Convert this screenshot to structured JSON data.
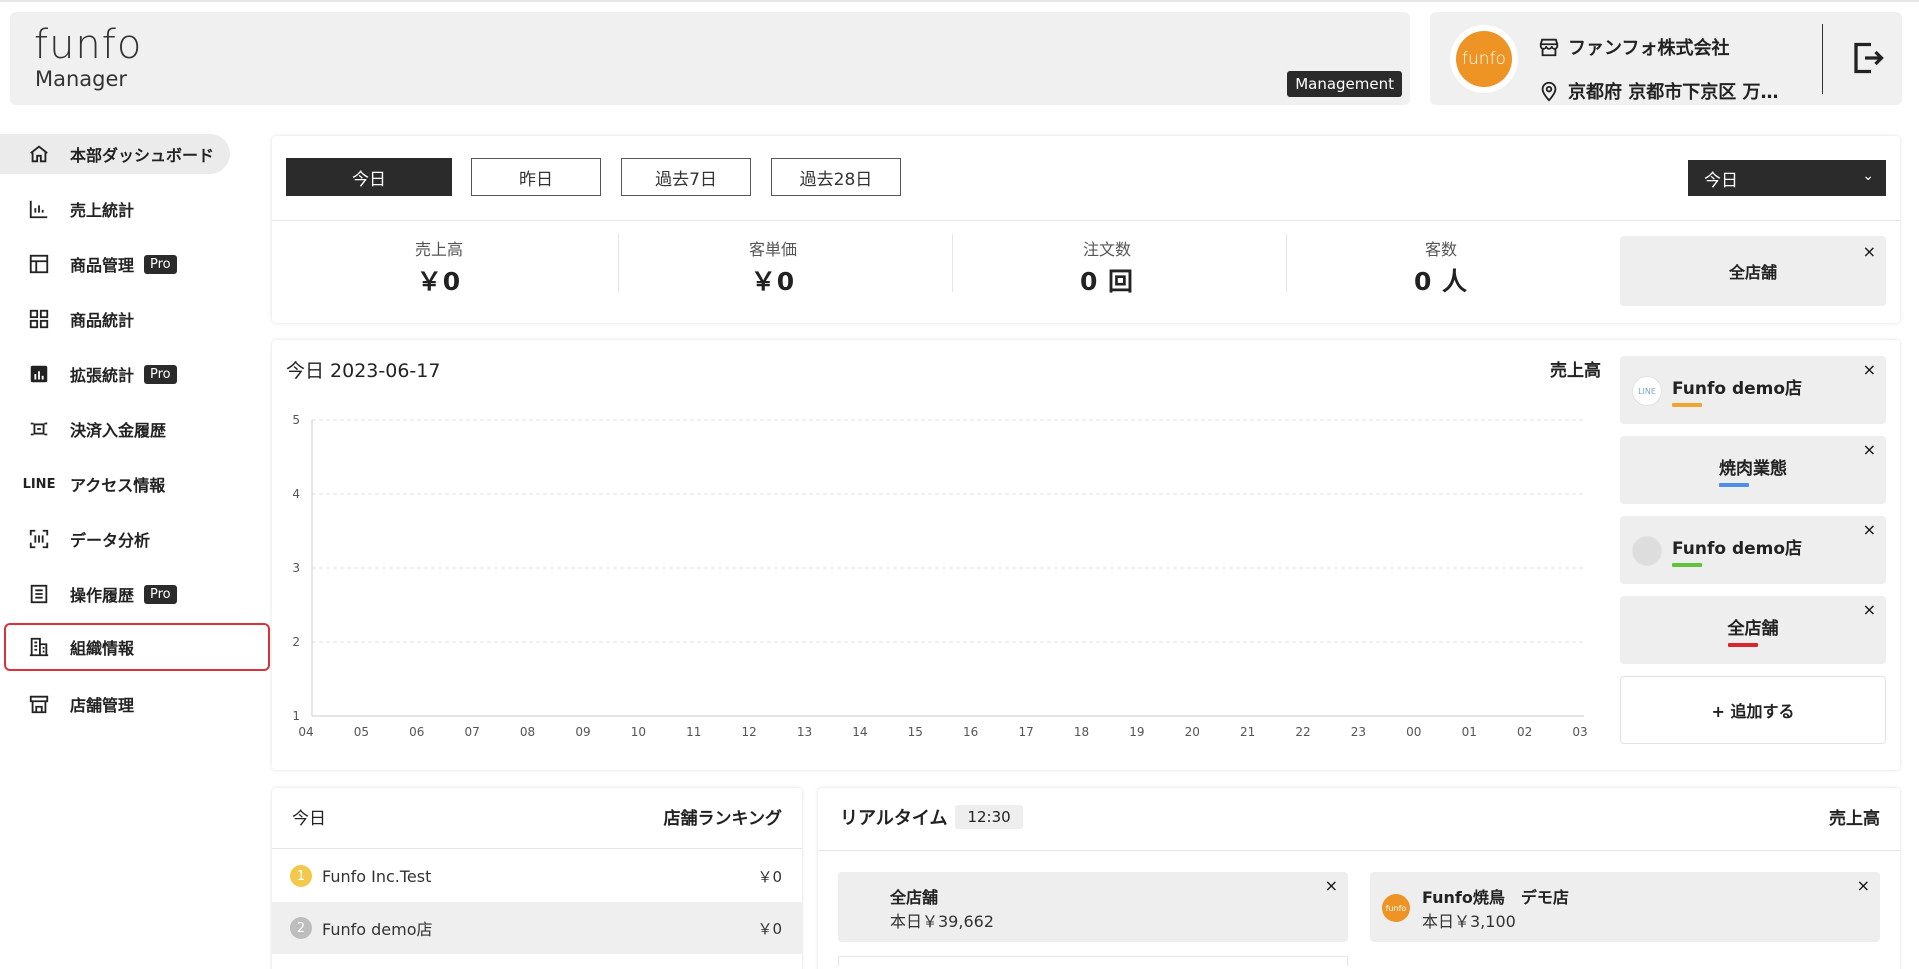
{
  "header": {
    "logo_word": "funfo",
    "logo_sub": "Manager",
    "mode_badge": "Management",
    "company_name": "ファンフォ株式会社",
    "address": "京都府 京都市下京区 万…",
    "store_avatar_text": "funfo"
  },
  "sidebar": {
    "items": [
      {
        "label": "本部ダッシュボード",
        "icon": "home-icon"
      },
      {
        "label": "売上統計",
        "icon": "bar-chart-icon"
      },
      {
        "label": "商品管理",
        "icon": "layout-icon",
        "badge": "Pro"
      },
      {
        "label": "商品統計",
        "icon": "grid-icon"
      },
      {
        "label": "拡張統計",
        "icon": "stats-icon",
        "badge": "Pro"
      },
      {
        "label": "決済入金履歴",
        "icon": "payment-icon"
      },
      {
        "label": "アクセス情報",
        "icon": "line-icon",
        "icon_text": "LINE"
      },
      {
        "label": "データ分析",
        "icon": "scan-icon"
      },
      {
        "label": "操作履歴",
        "icon": "list-icon",
        "badge": "Pro"
      },
      {
        "label": "組織情報",
        "icon": "building-icon"
      },
      {
        "label": "店舗管理",
        "icon": "store-icon"
      }
    ]
  },
  "period": {
    "buttons": [
      "今日",
      "昨日",
      "過去7日",
      "過去28日"
    ],
    "select_value": "今日",
    "metrics": [
      {
        "label": "売上高",
        "value": "￥0"
      },
      {
        "label": "客単価",
        "value": "￥0"
      },
      {
        "label": "注文数",
        "value": "0 回"
      },
      {
        "label": "客数",
        "value": "0 人"
      }
    ],
    "store_chip": "全店舗"
  },
  "chart": {
    "title": "今日 2023-06-17",
    "metric_label": "売上高",
    "add_label": "+ 追加する",
    "legend": [
      {
        "name": "Funfo demo店",
        "color": "#f0a531",
        "avatar": "LINE"
      },
      {
        "name": "焼肉業態",
        "color": "#4f8fe8"
      },
      {
        "name": "Funfo demo店",
        "color": "#5fc43a",
        "avatar": "gray"
      },
      {
        "name": "全店舗",
        "color": "#d9262e"
      }
    ]
  },
  "chart_data": {
    "type": "line",
    "x": [
      "04",
      "05",
      "06",
      "07",
      "08",
      "09",
      "10",
      "11",
      "12",
      "13",
      "14",
      "15",
      "16",
      "17",
      "18",
      "19",
      "20",
      "21",
      "22",
      "23",
      "00",
      "01",
      "02",
      "03"
    ],
    "ylim": [
      1,
      5
    ],
    "yticks": [
      "1",
      "2",
      "3",
      "4",
      "5"
    ],
    "series": [
      {
        "name": "Funfo demo店",
        "values": []
      },
      {
        "name": "焼肉業態",
        "values": []
      },
      {
        "name": "Funfo demo店",
        "values": []
      },
      {
        "name": "全店舗",
        "values": []
      }
    ],
    "grid": true
  },
  "ranking": {
    "title": "今日",
    "right_label": "店舗ランキング",
    "rows": [
      {
        "rank": "1",
        "name": "Funfo Inc.Test",
        "value": "￥0",
        "color": "#f2c94c"
      },
      {
        "rank": "2",
        "name": "Funfo demo店",
        "value": "￥0",
        "color": "#bdbdbd"
      }
    ]
  },
  "realtime": {
    "title": "リアルタイム",
    "time": "12:30",
    "right_label": "売上高",
    "chips": [
      {
        "name": "全店舗",
        "amount": "本日￥39,662"
      },
      {
        "name": "Funfo焼鳥　デモ店",
        "amount": "本日￥3,100",
        "avatar": "funfo"
      }
    ]
  },
  "close_glyph": "×"
}
